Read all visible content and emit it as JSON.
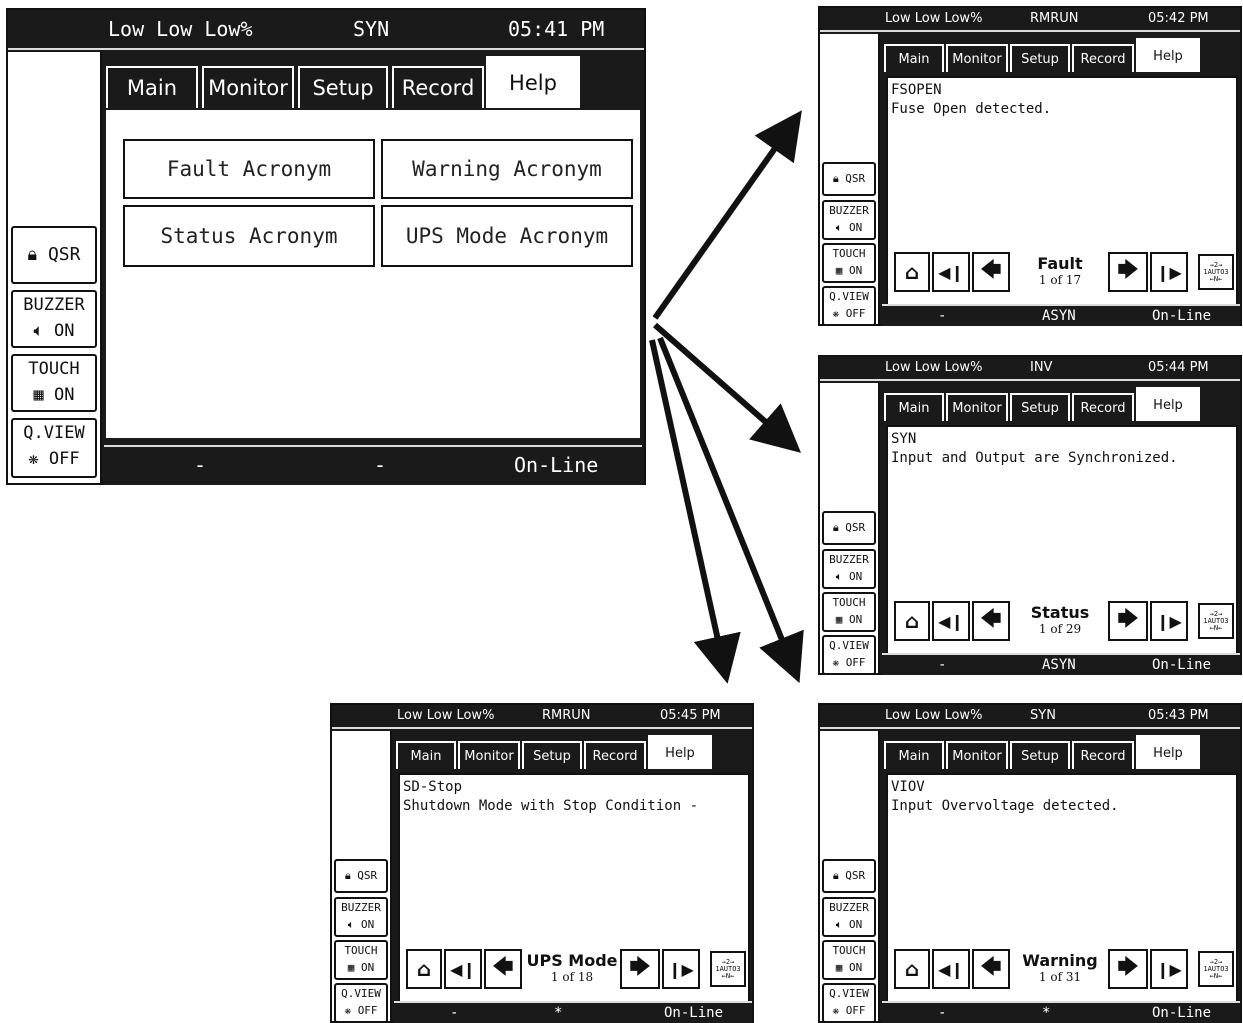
{
  "side_buttons": {
    "qsr": "QSR",
    "buzzer": "BUZZER",
    "buzzer_state": "ON",
    "touch": "TOUCH",
    "touch_state": "ON",
    "qview": "Q.VIEW",
    "qview_state": "OFF"
  },
  "tabs": [
    "Main",
    "Monitor",
    "Setup",
    "Record",
    "Help"
  ],
  "auto_label": "AUTO",
  "main_screen": {
    "title": "Low Low Low%",
    "mode": "SYN",
    "time": "05:41 PM",
    "buttons": [
      "Fault Acronym",
      "Warning Acronym",
      "Status Acronym",
      "UPS Mode Acronym"
    ],
    "status": [
      "-",
      "-",
      "On-Line"
    ]
  },
  "screens": [
    {
      "title": "Low Low Low%",
      "mode": "RMRUN",
      "time": "05:42 PM",
      "code": "FSOPEN",
      "description": "Fuse Open detected.",
      "category": "Fault",
      "counter": "1 of 17",
      "status": [
        "-",
        "ASYN",
        "On-Line"
      ]
    },
    {
      "title": "Low Low Low%",
      "mode": "INV",
      "time": "05:44 PM",
      "code": "SYN",
      "description": "Input and Output are Synchronized.",
      "category": "Status",
      "counter": "1 of 29",
      "status": [
        "-",
        "ASYN",
        "On-Line"
      ]
    },
    {
      "title": "Low Low Low%",
      "mode": "SYN",
      "time": "05:43 PM",
      "code": "VIOV",
      "description": "Input Overvoltage detected.",
      "category": "Warning",
      "counter": "1 of 31",
      "status": [
        "-",
        "*",
        "On-Line"
      ]
    },
    {
      "title": "Low Low Low%",
      "mode": "RMRUN",
      "time": "05:45 PM",
      "code": "SD-Stop",
      "description": "Shutdown Mode with Stop Condition -",
      "category": "UPS Mode",
      "counter": "1 of 18",
      "status": [
        "-",
        "*",
        "On-Line"
      ]
    }
  ]
}
